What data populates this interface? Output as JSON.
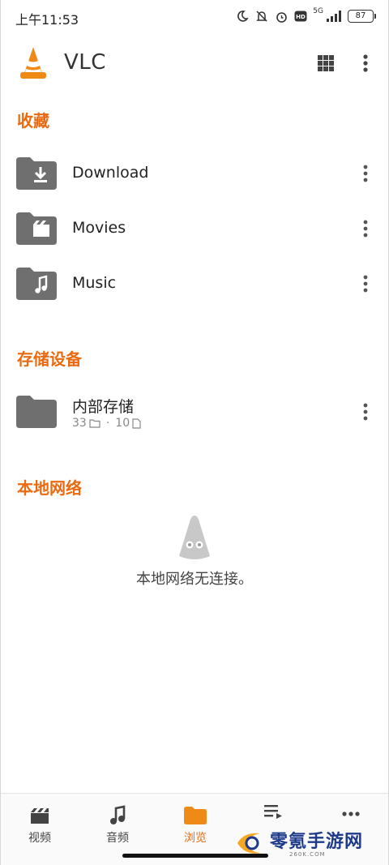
{
  "status_bar": {
    "time": "上午11:53",
    "network": "5G",
    "battery": "87",
    "icons": [
      "moon-icon",
      "mute-bell-icon",
      "alarm-icon",
      "hd-icon",
      "signal-icon",
      "battery-icon"
    ]
  },
  "app_bar": {
    "title": "VLC",
    "icons": [
      "vlc-cone-logo",
      "grid-view-icon",
      "more-vert-icon"
    ]
  },
  "favorites": {
    "title": "收藏",
    "items": [
      {
        "label": "Download",
        "icon": "folder-download-icon"
      },
      {
        "label": "Movies",
        "icon": "folder-movie-icon"
      },
      {
        "label": "Music",
        "icon": "folder-music-icon"
      }
    ]
  },
  "storage": {
    "title": "存储设备",
    "items": [
      {
        "label": "内部存储",
        "folders": "33",
        "separator": "·",
        "files": "10",
        "icon": "folder-icon"
      }
    ]
  },
  "local_network": {
    "title": "本地网络",
    "empty_message": "本地网络无连接。"
  },
  "bottom_nav": {
    "items": [
      {
        "label": "视频",
        "icon": "video-icon",
        "active": false
      },
      {
        "label": "音频",
        "icon": "music-note-icon",
        "active": false
      },
      {
        "label": "浏览",
        "icon": "folder-icon",
        "active": true
      },
      {
        "label": "",
        "icon": "playlist-icon",
        "active": false
      },
      {
        "label": "",
        "icon": "more-horiz-icon",
        "active": false
      }
    ]
  },
  "watermark": {
    "text": "零氪手游网",
    "sub": "260K.COM"
  },
  "colors": {
    "accent": "#e96a10",
    "folder": "#6f6f6f",
    "text": "#222222",
    "muted": "#888888"
  }
}
